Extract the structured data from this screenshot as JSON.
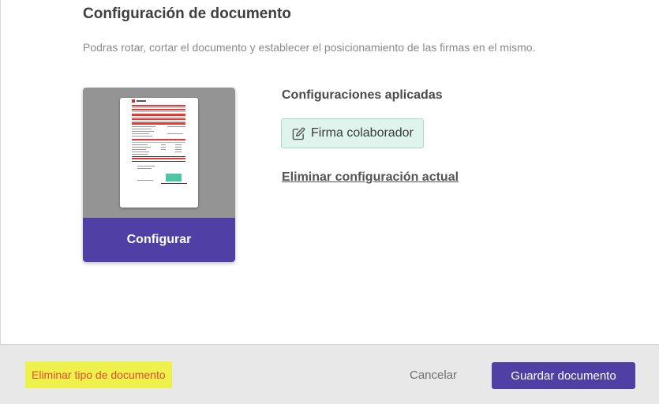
{
  "page": {
    "title": "Configuración de documento",
    "description": "Podras rotar, cortar el documento y establecer el posicionamiento de las firmas en el mismo."
  },
  "document_card": {
    "configure_label": "Configurar"
  },
  "applied": {
    "title": "Configuraciones aplicadas",
    "chip_label": "Firma colaborador",
    "chip_icon": "edit-icon",
    "remove_label": "Eliminar configuración actual"
  },
  "footer": {
    "delete_type_label": "Eliminar tipo de documento",
    "cancel_label": "Cancelar",
    "save_label": "Guardar documento"
  },
  "colors": {
    "primary": "#5040a6",
    "chip_bg": "#dff4ec",
    "highlight": "#eef14b",
    "danger_text": "#e0502e"
  }
}
